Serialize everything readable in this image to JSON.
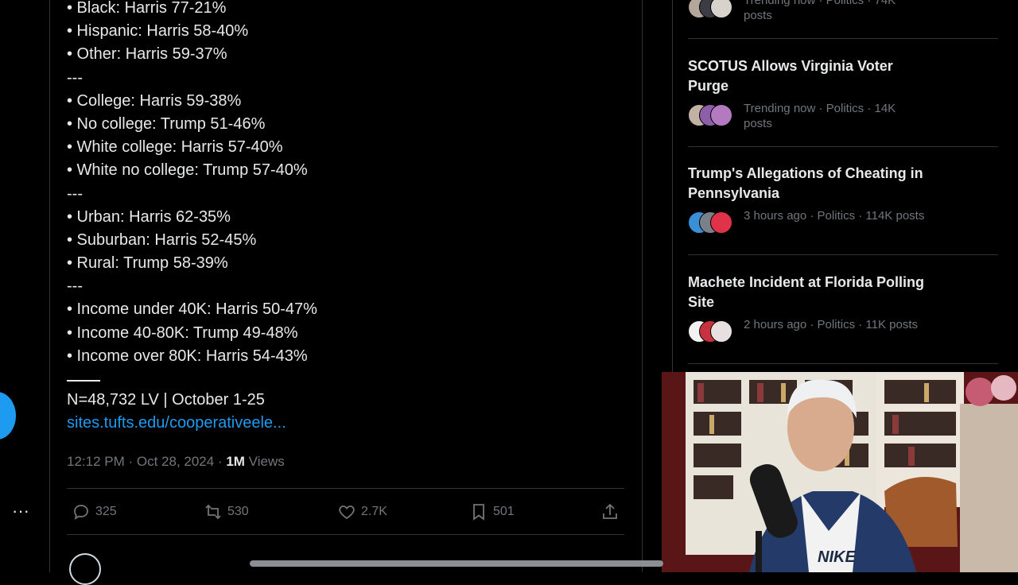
{
  "tweet": {
    "lines": [
      "• Black: Harris 77-21%",
      "• Hispanic: Harris 58-40%",
      "• Other: Harris 59-37%",
      "---",
      "• College: Harris 59-38%",
      "• No college: Trump 51-46%",
      "• White college: Harris 57-40%",
      "• White no college: Trump 57-40%",
      "---",
      "• Urban: Harris 62-35%",
      "• Suburban: Harris 52-45%",
      "• Rural: Trump 58-39%",
      "---",
      "• Income under 40K: Harris 50-47%",
      "• Income 40-80K: Trump 49-48%",
      "• Income over 80K: Harris 54-43%"
    ],
    "sample": "N=48,732 LV | October 1-25",
    "link": "sites.tufts.edu/cooperativeele...",
    "timestamp": "12:12 PM · Oct 28, 2024 · ",
    "views_count": "1M",
    "views_label": " Views",
    "actions": {
      "replies": "325",
      "reposts": "530",
      "likes": "2.7K",
      "bookmarks": "501"
    }
  },
  "trends": [
    {
      "title": "",
      "meta": "Trending now · Politics · 74K posts"
    },
    {
      "title": "SCOTUS Allows Virginia Voter Purge",
      "meta": "Trending now · Politics · 14K posts"
    },
    {
      "title": "Trump's Allegations of Cheating in Pennsylvania",
      "meta": "3 hours ago · Politics · 114K posts"
    },
    {
      "title": "Machete Incident at Florida Polling Site",
      "meta": "2 hours ago · Politics · 11K posts"
    }
  ],
  "webcam": {
    "shirt_text": "NIKE"
  },
  "icons": {
    "more": "more-icon",
    "reply": "reply-icon",
    "repost": "repost-icon",
    "like": "heart-icon",
    "bookmark": "bookmark-icon",
    "share": "share-icon"
  },
  "colors": {
    "background": "#000000",
    "text": "#e7e9ea",
    "muted": "#71767b",
    "link": "#1d9bf0",
    "border": "#2f3336"
  }
}
